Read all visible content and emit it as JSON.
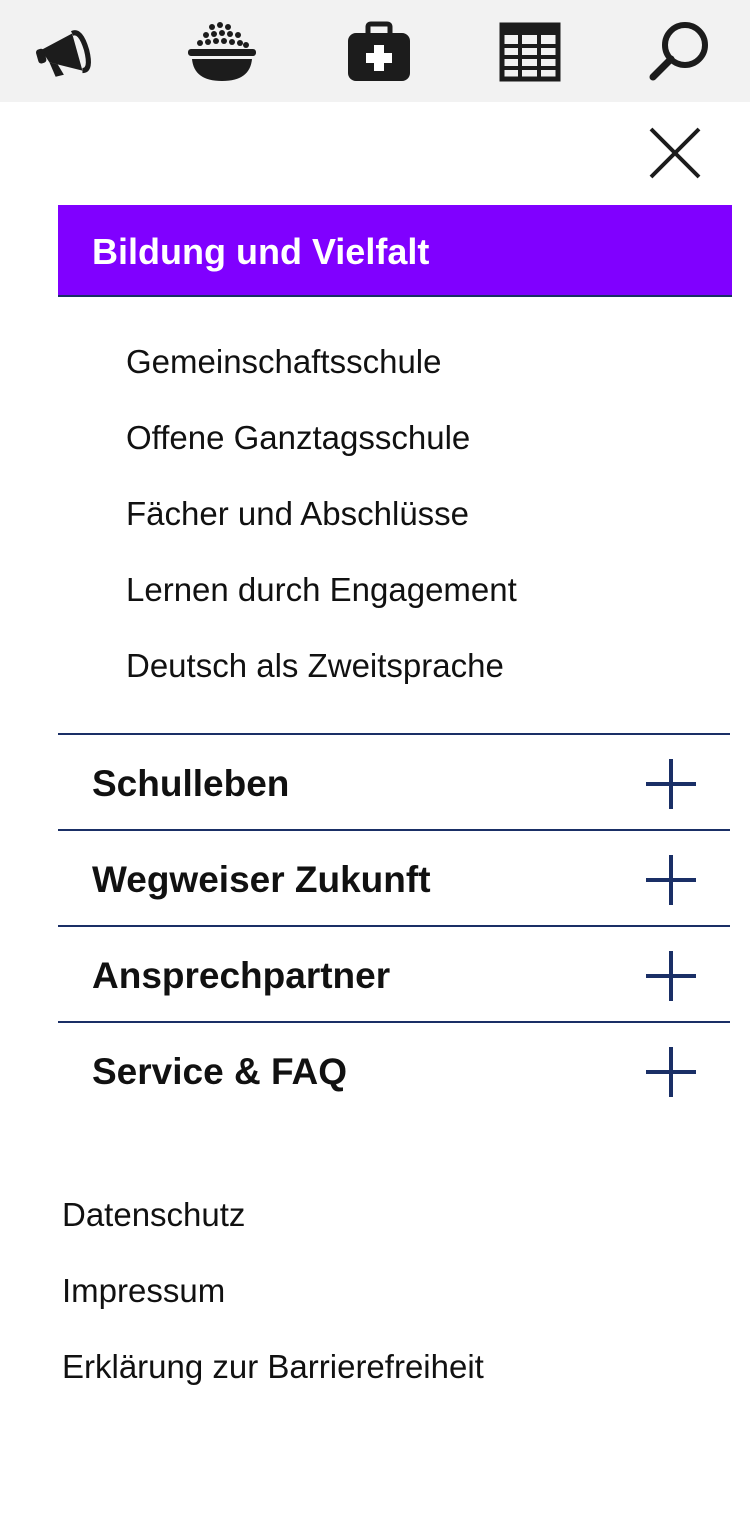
{
  "topbar": {
    "icons": [
      {
        "name": "megaphone-icon"
      },
      {
        "name": "food-bowl-icon"
      },
      {
        "name": "first-aid-kit-icon"
      },
      {
        "name": "calendar-grid-icon"
      },
      {
        "name": "search-icon"
      }
    ]
  },
  "menu": {
    "close_icon": "close-icon",
    "active_section": {
      "label": "Bildung und Vielfalt",
      "color": "#8000ff",
      "subitems": [
        "Gemeinschaftsschule",
        "Offene Ganztagsschule",
        "Fächer und Abschlüsse",
        "Lernen durch Engagement",
        "Deutsch als Zweitsprache"
      ]
    },
    "sections": [
      {
        "label": "Schulleben"
      },
      {
        "label": "Wegweiser Zukunft"
      },
      {
        "label": "Ansprechpartner"
      },
      {
        "label": "Service & FAQ"
      }
    ],
    "accent_color": "#1a2f66"
  },
  "footer": {
    "links": [
      "Datenschutz",
      "Impressum",
      "Erklärung zur Barrierefreiheit"
    ]
  }
}
